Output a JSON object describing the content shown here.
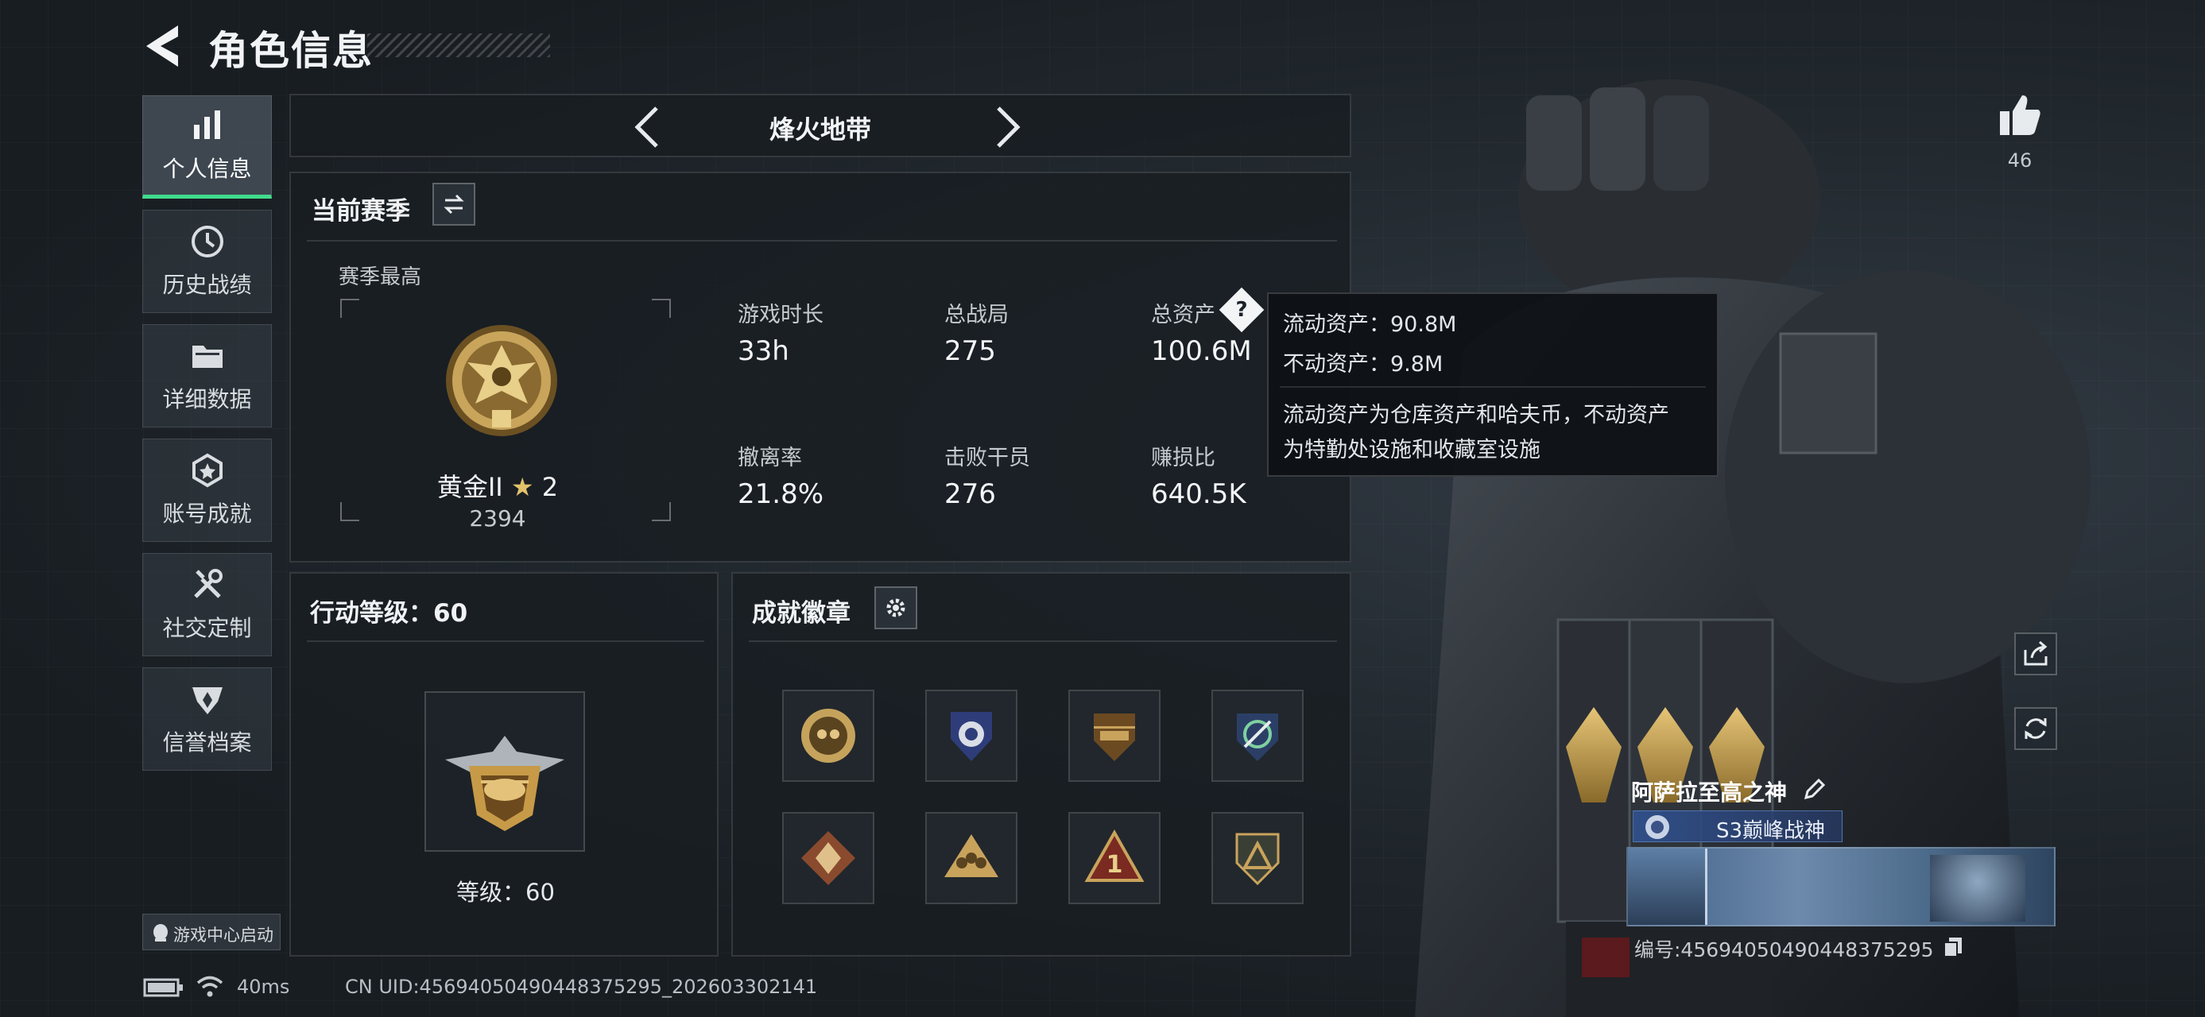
{
  "header": {
    "title": "角色信息"
  },
  "nav": {
    "items": [
      {
        "label": "个人信息",
        "icon": "bar-chart-icon",
        "active": true
      },
      {
        "label": "历史战绩",
        "icon": "clock-icon",
        "active": false
      },
      {
        "label": "详细数据",
        "icon": "folder-icon",
        "active": false
      },
      {
        "label": "账号成就",
        "icon": "achievement-icon",
        "active": false
      },
      {
        "label": "社交定制",
        "icon": "tools-icon",
        "active": false
      },
      {
        "label": "信誉档案",
        "icon": "shield-wing-icon",
        "active": false
      }
    ]
  },
  "mode": {
    "title": "烽火地带"
  },
  "season": {
    "title": "当前赛季",
    "best_label": "赛季最高",
    "rank_name": "黄金II",
    "rank_stars": "2",
    "rank_score": "2394",
    "stats": [
      {
        "label": "游戏时长",
        "value": "33h"
      },
      {
        "label": "总战局",
        "value": "275"
      },
      {
        "label": "总资产",
        "value": "100.6M"
      },
      {
        "label": "撤离率",
        "value": "21.8%"
      },
      {
        "label": "击败干员",
        "value": "276"
      },
      {
        "label": "赚损比",
        "value": "640.5K"
      }
    ]
  },
  "tooltip": {
    "liquid": "流动资产：90.8M",
    "fixed": "不动资产：9.8M",
    "desc_line1": "流动资产为仓库资产和哈夫币，不动资产",
    "desc_line2": "为特勤处设施和收藏室设施"
  },
  "action_level": {
    "title": "行动等级：60",
    "level_text": "等级：60"
  },
  "badges": {
    "title": "成就徽章",
    "items": [
      "skull-badge-icon",
      "eagle-shield-badge-icon",
      "helicopter-badge-icon",
      "target-badge-icon",
      "wolf-badge-icon",
      "squad-badge-icon",
      "number-one-badge-icon",
      "triangle-badge-icon"
    ]
  },
  "character": {
    "likes": "46",
    "name": "阿萨拉至高之神",
    "title_badge": "S3巅峰战神",
    "uid": "编号:4569405049044837529​5"
  },
  "footer": {
    "launch_text": "游戏中心启动",
    "ping": "40ms",
    "uid": "CN UID:456940504904483752​95_202603302141"
  },
  "colors": {
    "accent": "#3fdc8c",
    "gold": "#d4b062",
    "panel_bg": "#181d22"
  }
}
